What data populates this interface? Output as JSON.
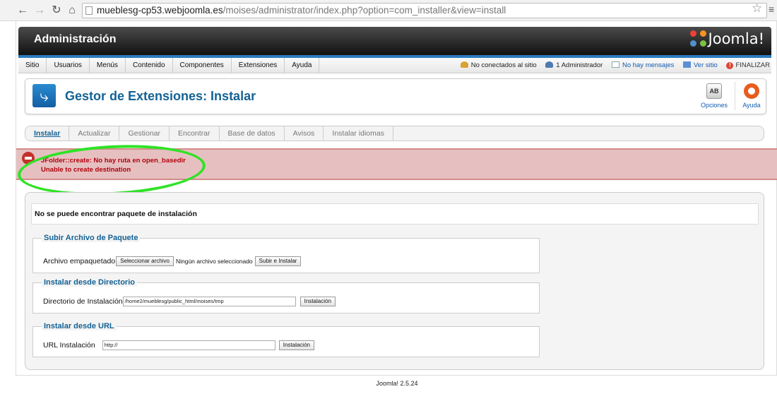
{
  "browser": {
    "url_host": "mueblesg-cp53.webjoomla.es",
    "url_path": "/moises/administrator/index.php?option=com_installer&view=install"
  },
  "header": {
    "title": "Administración",
    "logo_text": "Joomla!"
  },
  "menu": [
    "Sitio",
    "Usuarios",
    "Menús",
    "Contenido",
    "Componentes",
    "Extensiones",
    "Ayuda"
  ],
  "status": {
    "visitors": "No conectados al sitio",
    "admins": "1 Administrador",
    "messages": "No hay mensajes",
    "view_site": "Ver sitio",
    "logout": "FINALIZAR"
  },
  "page": {
    "title": "Gestor de Extensiones: Instalar",
    "toolbar": {
      "options": "Opciones",
      "help": "Ayuda"
    }
  },
  "subnav": [
    "Instalar",
    "Actualizar",
    "Gestionar",
    "Encontrar",
    "Base de datos",
    "Avisos",
    "Instalar idiomas"
  ],
  "error": {
    "line1": "JFolder::create: No hay ruta en open_basedir",
    "line2": "Unable to create destination"
  },
  "message": "No se puede encontrar paquete de instalación",
  "upload": {
    "legend": "Subir Archivo de Paquete",
    "label": "Archivo empaquetado",
    "select_btn": "Seleccionar archivo",
    "no_file": "Ningún archivo seleccionado",
    "submit": "Subir e Instalar"
  },
  "directory": {
    "legend": "Instalar desde Directorio",
    "label": "Directorio de Instalación",
    "value": "/home2/mueblesg/public_html/moises/tmp",
    "submit": "Instalación"
  },
  "url": {
    "legend": "Instalar desde URL",
    "label": "URL Instalación",
    "value": "http://",
    "submit": "Instalación"
  },
  "footer": "Joomla! 2.5.24",
  "colors": {
    "accent": "#146295",
    "error_bg": "#e6c0c0",
    "error_text": "#b0000d",
    "annotation": "#2ee325"
  }
}
